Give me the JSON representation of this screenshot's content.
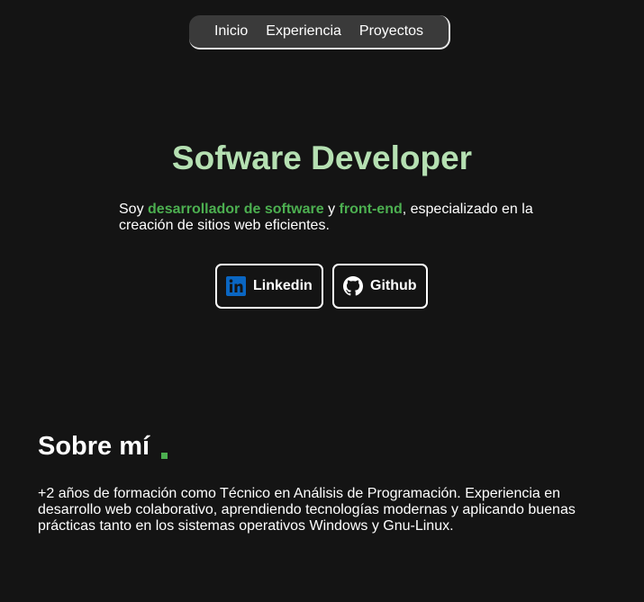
{
  "nav": {
    "items": [
      {
        "label": "Inicio"
      },
      {
        "label": "Experiencia"
      },
      {
        "label": "Proyectos"
      }
    ]
  },
  "hero": {
    "title": "Sofware Developer",
    "description": {
      "prefix": "Soy ",
      "highlight_1": "desarrollador de software",
      "connector": " y ",
      "highlight_2": "front-end",
      "suffix": ", especializado en la creación de sitios web eficientes."
    },
    "buttons": {
      "linkedin": {
        "label": "Linkedin",
        "icon": "linkedin-icon"
      },
      "github": {
        "label": "Github",
        "icon": "github-icon"
      }
    }
  },
  "about": {
    "title": "Sobre mí",
    "text": "+2 años de formación como Técnico en Análisis de Programación. Experiencia en desarrollo web colaborativo, aprendiendo tecnologías modernas y aplicando buenas prácticas tanto en los sistemas operativos Windows y Gnu-Linux."
  },
  "colors": {
    "background": "#141414",
    "accent": "#4caf50",
    "title": "#b5e0b2",
    "nav_background": "#3a3a3a"
  }
}
